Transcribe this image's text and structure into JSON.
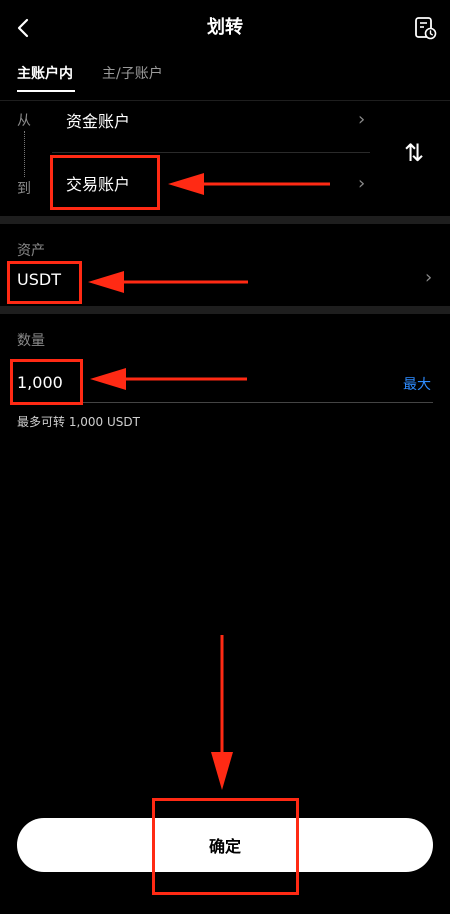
{
  "header": {
    "title": "划转"
  },
  "tabs": [
    {
      "label": "主账户内",
      "active": true
    },
    {
      "label": "主/子账户",
      "active": false
    }
  ],
  "transfer": {
    "from_label": "从",
    "to_label": "到",
    "from_account": "资金账户",
    "to_account": "交易账户",
    "swap_glyph": "⇅"
  },
  "asset": {
    "label": "资产",
    "value": "USDT"
  },
  "amount": {
    "label": "数量",
    "value": "1,000",
    "max_label": "最大",
    "available_text": "最多可转  1,000 USDT"
  },
  "confirm": {
    "label": "确定"
  },
  "colors": {
    "annotation": "#ff2a14",
    "accent": "#2e8cff"
  }
}
